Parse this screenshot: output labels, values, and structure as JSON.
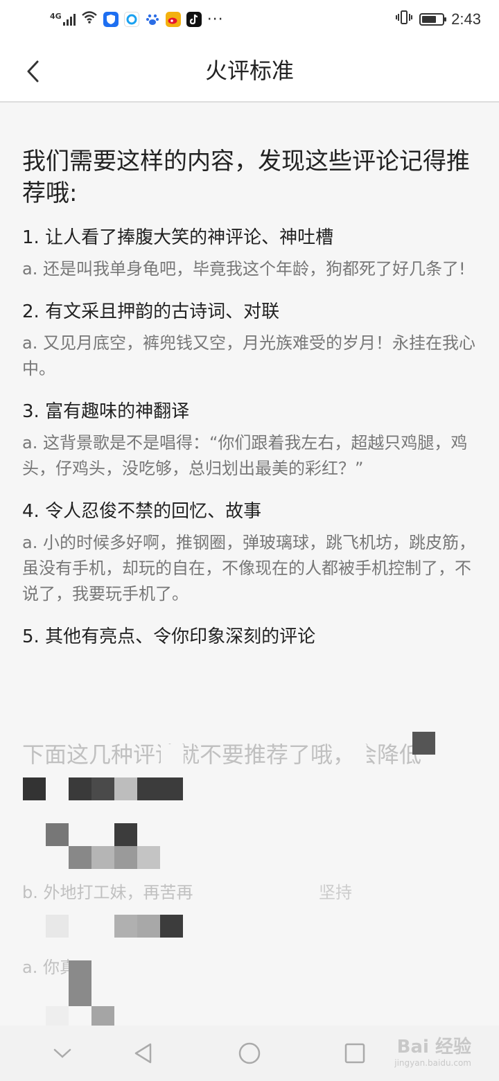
{
  "status_bar": {
    "network": "4G",
    "time": "2:43",
    "battery_level": 0.7,
    "notification_icons": [
      "wifi-icon",
      "shield-app-icon",
      "browser-app-icon",
      "baidu-app-icon",
      "weibo-app-icon",
      "tiktok-app-icon",
      "more-dots-icon"
    ],
    "more": "···"
  },
  "header": {
    "title": "火评标准"
  },
  "content": {
    "intro": "我们需要这样的内容，发现这些评论记得推荐哦:",
    "items": [
      {
        "title": "1. 让人看了捧腹大笑的神评论、神吐槽",
        "example": "a. 还是叫我单身龟吧，毕竟我这个年龄，狗都死了好几条了!"
      },
      {
        "title": "2. 有文采且押韵的古诗词、对联",
        "example": "a. 又见月底空，裤兜钱又空，月光族难受的岁月！永挂在我心中。"
      },
      {
        "title": "3. 富有趣味的神翻译",
        "example": "a. 这背景歌是不是唱得：“你们跟着我左右，超越只鸡腿，鸡头，仔鸡头，没吃够，总归划出最美的彩红？”"
      },
      {
        "title": "4. 令人忍俊不禁的回忆、故事",
        "example": "a. 小的时候多好啊，推钢圈，弹玻璃球，跳飞机坊，跳皮筋，虽没有手机，却玩的自在，不像现在的人都被手机控制了，不说了，我要玩手机了。"
      },
      {
        "title": "5. 其他有亮点、令你印象深刻的评论",
        "example": ""
      }
    ],
    "obscured": {
      "heading": "下面这几种评论就不要推荐了哦，会降低",
      "line_b": "b. 外地打工妹，再苦再",
      "line_b2": "坚持",
      "line_a": "a. 你真"
    }
  },
  "watermark": {
    "brand": "Bai 经验",
    "url": "jingyan.baidu.com"
  }
}
